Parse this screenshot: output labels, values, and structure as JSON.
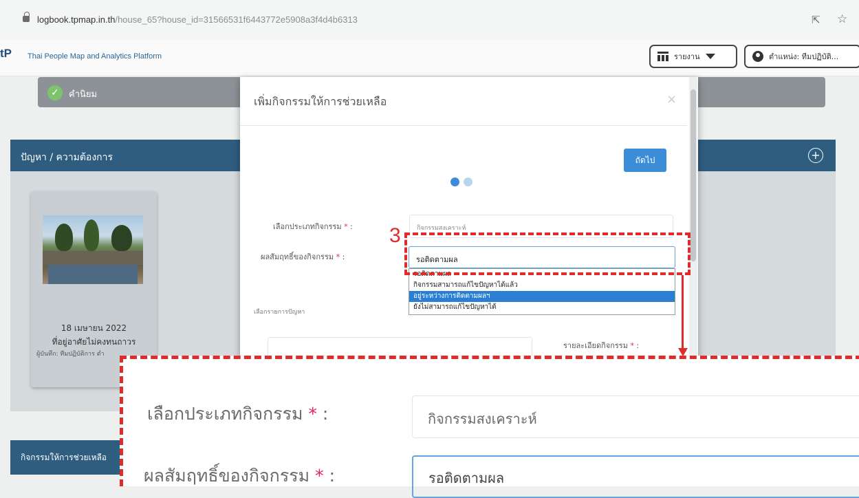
{
  "browser": {
    "url_host": "logbook.tpmap.in.th",
    "url_path": "/house_65?house_id=31566531f6443772e5908a3f4d4b6313"
  },
  "nav": {
    "logo": "tP",
    "brand": "Thai People Map and Analytics Platform",
    "report_label": "รายงาน",
    "role_label": "ตำแหน่ง: ทีมปฏิบัติ..."
  },
  "status": {
    "label": "คำนิยม"
  },
  "problem_panel": {
    "title": "ปัญหา / ความต้องการ",
    "card": {
      "date": "18 เมษายน 2022",
      "title": "ที่อยู่อาศัยไม่คงทนถาวร",
      "recorder": "ผู้บันทึก: ทีมปฏิบัติการ ตำ"
    }
  },
  "activity_panel": {
    "title": "กิจกรรมให้การช่วยเหลือ"
  },
  "modal": {
    "title": "เพิ่มกิจกรรมให้การช่วยเหลือ",
    "close": "×",
    "next_label": "ถัดไป",
    "type_label": "เลือกประเภทกิจกรรม",
    "required_mark": "*",
    "colon": ":",
    "type_value": "กิจกรรมสงเคราะห์",
    "result_label": "ผลสัมฤทธิ์ของกิจกรรม",
    "result_value": "รอติดตามผล",
    "result_options": [
      "รอติดตามผล",
      "กิจกรรมสามารถแก้ไขปัญหาได้แล้ว",
      "อยู่ระหว่างการติดตามผลฯ",
      "ยังไม่สามารถแก้ไขปัญหาได้"
    ],
    "problem_select_label": "เลือกรายการปัญหา",
    "detail_label": "รายละเอียดกิจกรรม"
  },
  "annotation": {
    "step_number": "3",
    "color": "#e02b2b"
  },
  "zoom": {
    "type_label": "เลือกประเภทกิจกรรม",
    "type_value": "กิจกรรมสงเคราะห์",
    "result_label": "ผลสัมฤทธิ์ของกิจกรรม",
    "result_value": "รอติดตามผล"
  },
  "colors": {
    "accent": "#3c8dd8",
    "header": "#2f5d80",
    "required": "#e0245e"
  }
}
